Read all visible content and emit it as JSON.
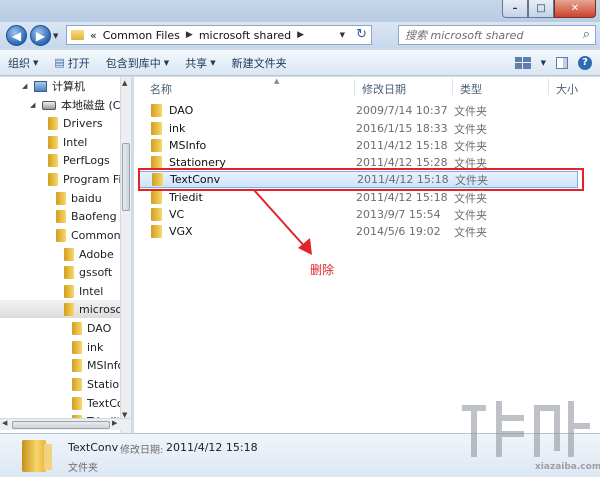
{
  "window": {
    "min_glyph": "–",
    "max_glyph": "□",
    "close_glyph": "✕"
  },
  "address_bar": {
    "breadcrumbs": [
      "«",
      "Common Files",
      "microsoft shared"
    ],
    "search_placeholder": "搜索 microsoft shared"
  },
  "toolbar": {
    "organize": "组织",
    "open": "打开",
    "include_in_library": "包含到库中",
    "share": "共享",
    "new_folder": "新建文件夹"
  },
  "nav_tree": [
    {
      "label": "计算机",
      "kind": "pc"
    },
    {
      "label": "本地磁盘 (C:)",
      "kind": "disk"
    },
    {
      "label": "Drivers",
      "kind": "folder"
    },
    {
      "label": "Intel",
      "kind": "folder"
    },
    {
      "label": "PerfLogs",
      "kind": "folder"
    },
    {
      "label": "Program Fil",
      "kind": "folder"
    },
    {
      "label": "baidu",
      "kind": "folder"
    },
    {
      "label": "Baofeng",
      "kind": "folder"
    },
    {
      "label": "Common I",
      "kind": "folder"
    },
    {
      "label": "Adobe",
      "kind": "folder"
    },
    {
      "label": "gssoft",
      "kind": "folder"
    },
    {
      "label": "Intel",
      "kind": "folder"
    },
    {
      "label": "microsof",
      "kind": "folder",
      "selected": true
    },
    {
      "label": "DAO",
      "kind": "folder"
    },
    {
      "label": "ink",
      "kind": "folder"
    },
    {
      "label": "MSInfo",
      "kind": "folder"
    },
    {
      "label": "Station",
      "kind": "folder"
    },
    {
      "label": "TextCo",
      "kind": "folder"
    },
    {
      "label": "Triedit",
      "kind": "folder"
    }
  ],
  "columns": {
    "name": "名称",
    "modified": "修改日期",
    "type": "类型",
    "size": "大小"
  },
  "files": [
    {
      "name": "DAO",
      "modified": "2009/7/14 10:37",
      "type": "文件夹"
    },
    {
      "name": "ink",
      "modified": "2016/1/15 18:33",
      "type": "文件夹"
    },
    {
      "name": "MSInfo",
      "modified": "2011/4/12 15:18",
      "type": "文件夹"
    },
    {
      "name": "Stationery",
      "modified": "2011/4/12 15:28",
      "type": "文件夹"
    },
    {
      "name": "TextConv",
      "modified": "2011/4/12 15:18",
      "type": "文件夹",
      "selected": true
    },
    {
      "name": "Triedit",
      "modified": "2011/4/12 15:18",
      "type": "文件夹"
    },
    {
      "name": "VC",
      "modified": "2013/9/7 15:54",
      "type": "文件夹"
    },
    {
      "name": "VGX",
      "modified": "2014/5/6 19:02",
      "type": "文件夹"
    }
  ],
  "annotation": {
    "text": "删除",
    "color": "#e2232a"
  },
  "details": {
    "name": "TextConv",
    "modified_label": "修改日期:",
    "modified_value": "2011/4/12 15:18",
    "type": "文件夹"
  },
  "watermark": {
    "text": "xiazaiba.com"
  }
}
